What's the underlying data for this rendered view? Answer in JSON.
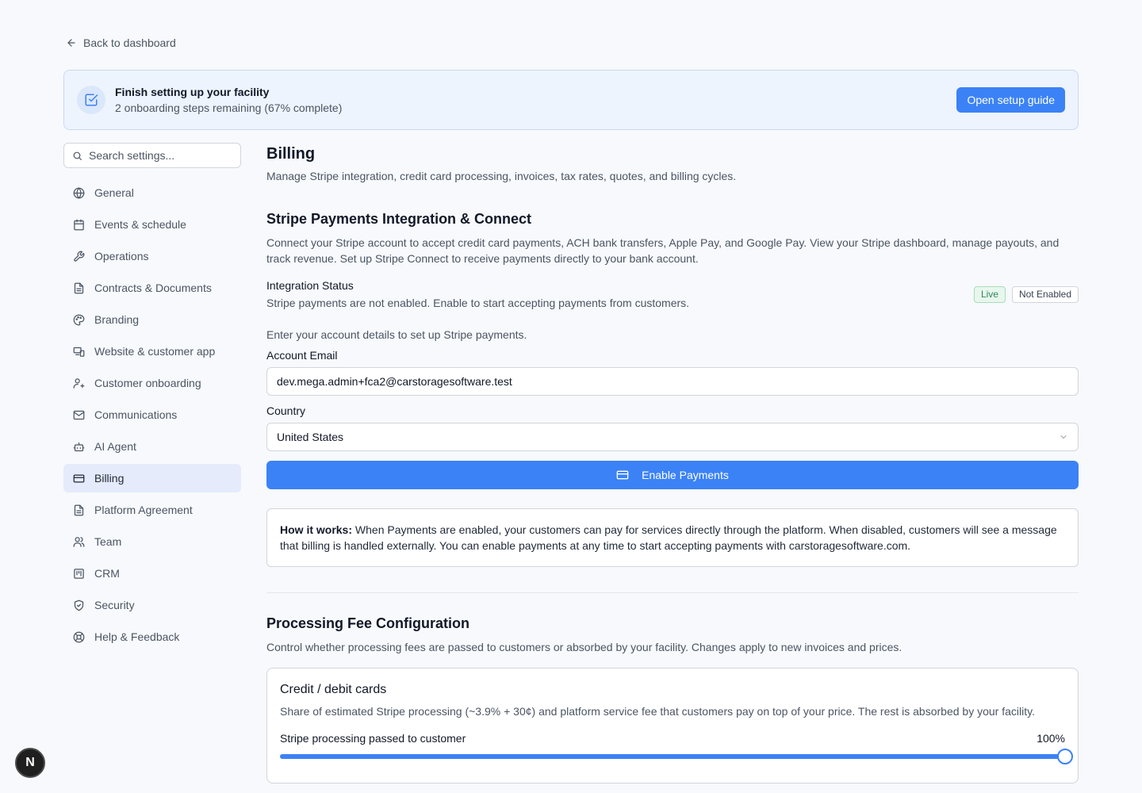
{
  "back_link": {
    "label": "Back to dashboard",
    "icon": "arrow-left-icon"
  },
  "banner": {
    "title": "Finish setting up your facility",
    "subtitle": "2 onboarding steps remaining (67% complete)",
    "button_label": "Open setup guide",
    "icon": "checkbox-icon"
  },
  "sidebar": {
    "search_placeholder": "Search settings...",
    "items": [
      {
        "label": "General",
        "icon": "globe-icon"
      },
      {
        "label": "Events & schedule",
        "icon": "calendar-icon"
      },
      {
        "label": "Operations",
        "icon": "wrench-icon"
      },
      {
        "label": "Contracts & Documents",
        "icon": "document-icon"
      },
      {
        "label": "Branding",
        "icon": "palette-icon"
      },
      {
        "label": "Website & customer app",
        "icon": "devices-icon"
      },
      {
        "label": "Customer onboarding",
        "icon": "user-plus-icon"
      },
      {
        "label": "Communications",
        "icon": "mail-icon"
      },
      {
        "label": "AI Agent",
        "icon": "bot-icon"
      },
      {
        "label": "Billing",
        "icon": "credit-card-icon",
        "active": true
      },
      {
        "label": "Platform Agreement",
        "icon": "document-icon"
      },
      {
        "label": "Team",
        "icon": "users-icon"
      },
      {
        "label": "CRM",
        "icon": "kanban-icon"
      },
      {
        "label": "Security",
        "icon": "shield-icon"
      },
      {
        "label": "Help & Feedback",
        "icon": "lifebuoy-icon"
      }
    ]
  },
  "billing": {
    "title": "Billing",
    "description": "Manage Stripe integration, credit card processing, invoices, tax rates, quotes, and billing cycles."
  },
  "stripe": {
    "title": "Stripe Payments Integration & Connect",
    "description": "Connect your Stripe account to accept credit card payments, ACH bank transfers, Apple Pay, and Google Pay. View your Stripe dashboard, manage payouts, and track revenue. Set up Stripe Connect to receive payments directly to your bank account.",
    "status_label": "Integration Status",
    "status_desc": "Stripe payments are not enabled. Enable to start accepting payments from customers.",
    "badge_live": "Live",
    "badge_status": "Not Enabled",
    "hint": "Enter your account details to set up Stripe payments.",
    "email_label": "Account Email",
    "email_value": "dev.mega.admin+fca2@carstoragesoftware.test",
    "country_label": "Country",
    "country_value": "United States",
    "enable_button": "Enable Payments",
    "info_bold": "How it works:",
    "info_text": " When Payments are enabled, your customers can pay for services directly through the platform. When disabled, customers will see a message that billing is handled externally. You can enable payments at any time to start accepting payments with carstoragesoftware.com."
  },
  "fees": {
    "title": "Processing Fee Configuration",
    "description": "Control whether processing fees are passed to customers or absorbed by your facility. Changes apply to new invoices and prices.",
    "card_title": "Credit / debit cards",
    "card_desc": "Share of estimated Stripe processing (~3.9% + 30¢) and platform service fee that customers pay on top of your price. The rest is absorbed by your facility.",
    "slider_label": "Stripe processing passed to customer",
    "slider_value_text": "100%",
    "slider_value": 1.0
  },
  "fab": {
    "label": "N"
  },
  "colors": {
    "accent": "#3b82f6",
    "active_nav_bg": "#e5ebfa",
    "banner_bg": "#eef4fd"
  }
}
